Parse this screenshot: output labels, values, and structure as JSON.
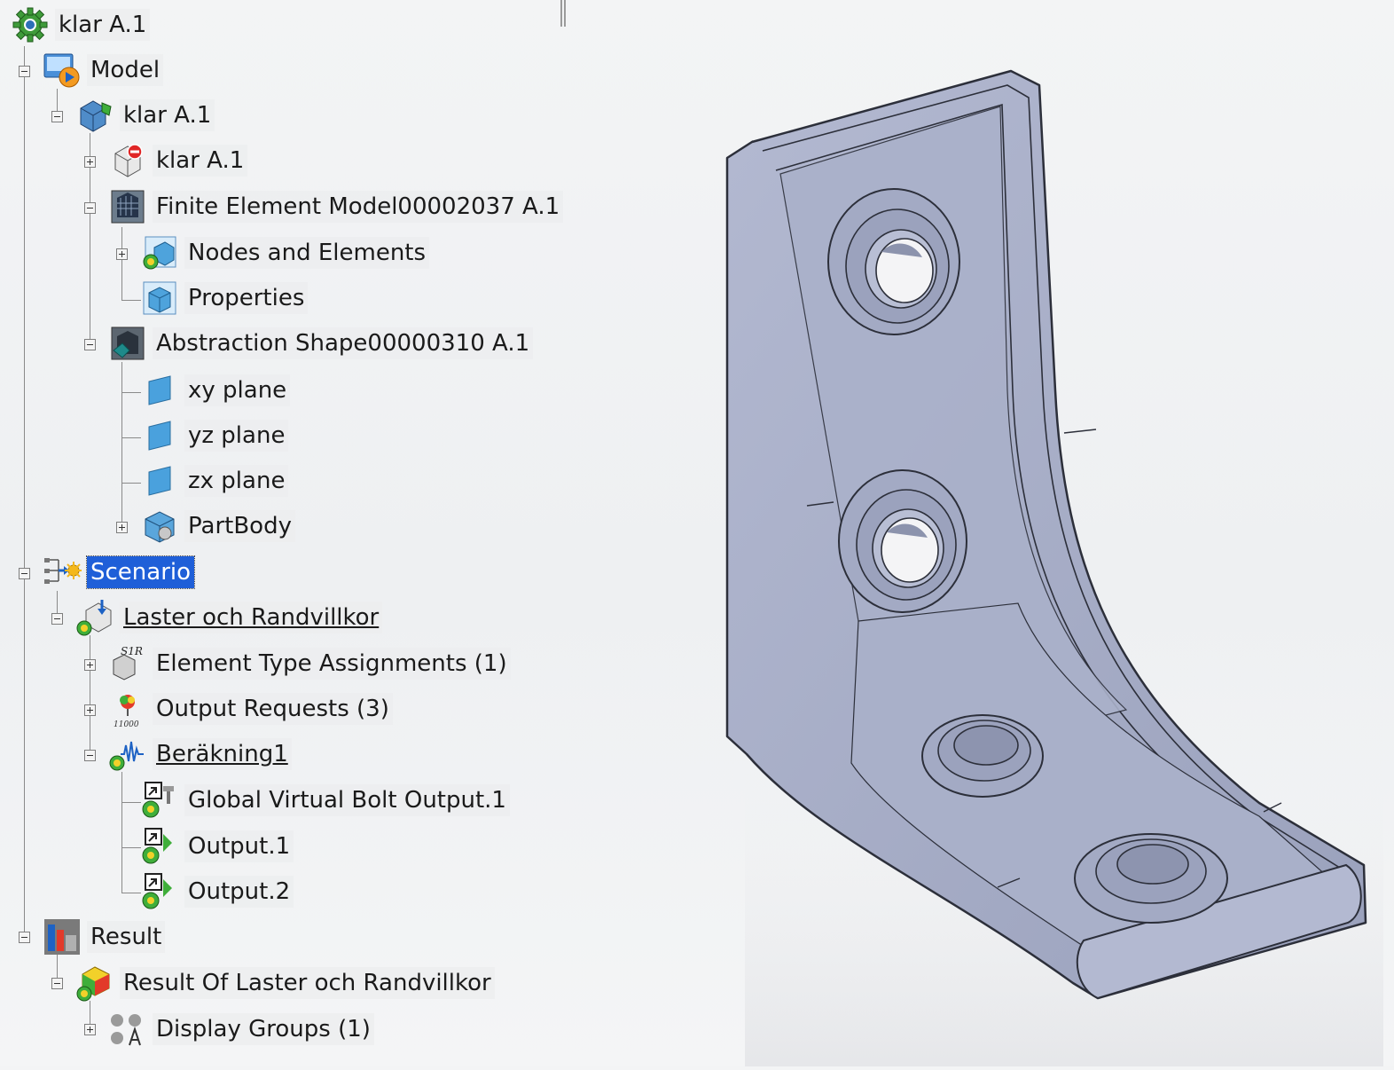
{
  "tree": {
    "root": "klar A.1",
    "model": "Model",
    "product": "klar A.1",
    "part": "klar A.1",
    "fem": "Finite Element Model00002037 A.1",
    "nodes_elements": "Nodes and Elements",
    "properties": "Properties",
    "abstraction": "Abstraction Shape00000310 A.1",
    "xy_plane": "xy plane",
    "yz_plane": "yz plane",
    "zx_plane": "zx plane",
    "partbody": "PartBody",
    "scenario": "Scenario",
    "loads": "Laster och Randvillkor",
    "element_types": "Element Type Assignments (1)",
    "output_requests": "Output Requests (3)",
    "output_requests_icon_text": "11000",
    "element_types_icon_text": "S1R",
    "calc": "Beräkning1",
    "global_bolt": "Global Virtual Bolt Output.1",
    "output1": "Output.1",
    "output2": "Output.2",
    "result": "Result",
    "result_of": "Result Of Laster och Randvillkor",
    "display_groups": "Display Groups (1)"
  },
  "colors": {
    "selection": "#1f5fd8",
    "part_fill": "#a3abc4",
    "part_edge": "#2c2f3a"
  },
  "viewport": {
    "object": "angle bracket 3D model"
  }
}
